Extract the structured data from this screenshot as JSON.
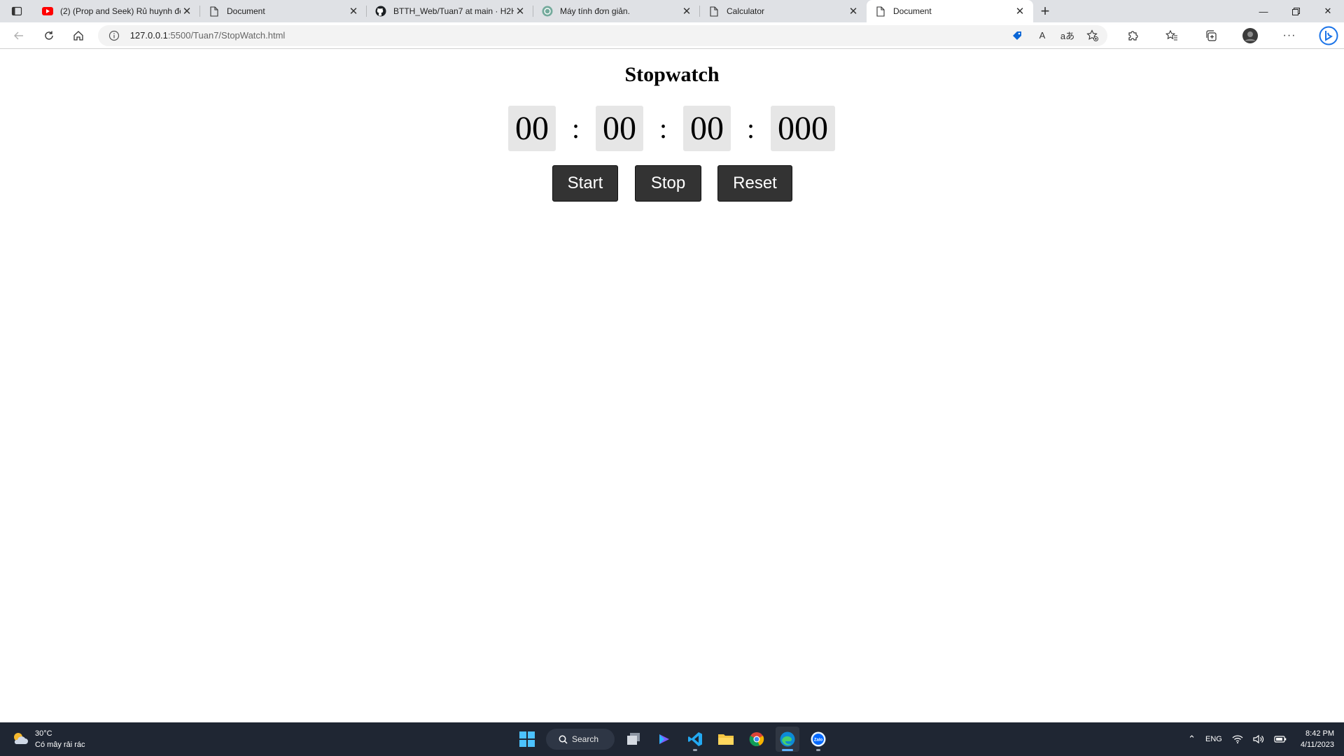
{
  "browser": {
    "tabs": [
      {
        "title": "(2) (Prop and Seek) Rủ huynh đệ",
        "icon": "youtube-icon",
        "active": false
      },
      {
        "title": "Document",
        "icon": "page-icon",
        "active": false
      },
      {
        "title": "BTTH_Web/Tuan7 at main · H2H",
        "icon": "github-icon",
        "active": false
      },
      {
        "title": "Máy tính đơn giản.",
        "icon": "openai-icon",
        "active": false
      },
      {
        "title": "Calculator",
        "icon": "page-icon",
        "active": false
      },
      {
        "title": "Document",
        "icon": "page-icon",
        "active": true
      }
    ],
    "url_host": "127.0.0.1",
    "url_rest": ":5500/Tuan7/StopWatch.html",
    "read_aloud_label": "A",
    "translate_label": "aあ"
  },
  "stopwatch": {
    "title": "Stopwatch",
    "hours": "00",
    "minutes": "00",
    "seconds": "00",
    "milliseconds": "000",
    "separator": ":",
    "buttons": {
      "start": "Start",
      "stop": "Stop",
      "reset": "Reset"
    }
  },
  "taskbar": {
    "weather_temp": "30°C",
    "weather_desc": "Có mây rải rác",
    "search_label": "Search",
    "zalo_label": "Zalo",
    "language": "ENG",
    "time": "8:42 PM",
    "date": "4/11/2023"
  },
  "colors": {
    "tab_strip": "#dfe1e5",
    "segment_bg": "#e6e6e6",
    "button_bg": "#333333",
    "taskbar_bg": "#1f2633"
  }
}
